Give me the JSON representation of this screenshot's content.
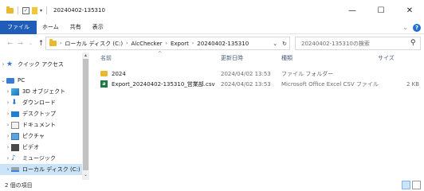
{
  "window": {
    "title": "20240402-135310",
    "min": "—",
    "max": "☐",
    "close": "✕"
  },
  "ribbon": {
    "tabs": [
      "ファイル",
      "ホーム",
      "共有",
      "表示"
    ]
  },
  "address": {
    "crumbs": [
      "ローカル ディスク (C:)",
      "AlcChecker",
      "Export",
      "20240402-135310"
    ],
    "search_placeholder": "20240402-135310の検索"
  },
  "nav": {
    "quick_access": "クイック アクセス",
    "pc": "PC",
    "items": [
      "3D オブジェクト",
      "ダウンロード",
      "デスクトップ",
      "ドキュメント",
      "ピクチャ",
      "ビデオ",
      "ミュージック",
      "ローカル ディスク (C:)"
    ]
  },
  "columns": {
    "name": "名前",
    "modified": "更新日時",
    "type": "種類",
    "size": "サイズ"
  },
  "files": [
    {
      "name": "2024",
      "modified": "2024/04/02 13:53",
      "type": "ファイル フォルダー",
      "size": "",
      "icon": "folder-icon"
    },
    {
      "name": "Export_20240402-135310_営業部.csv",
      "modified": "2024/04/02 13:53",
      "type": "Microsoft Office Excel CSV ファイル",
      "size": "2 KB",
      "icon": "csv-file-icon"
    }
  ],
  "status": {
    "count": "2 個の項目"
  },
  "colors": {
    "file_tab": "#1f5db8",
    "selection": "#cce4f7",
    "folder": "#e8b930"
  }
}
